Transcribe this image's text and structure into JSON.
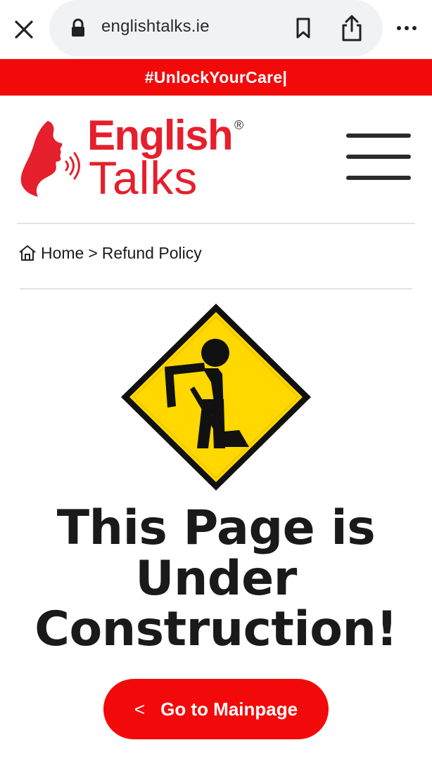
{
  "browser": {
    "url": "englishtalks.ie"
  },
  "announcement": {
    "text": "#UnlockYourCare|"
  },
  "logo": {
    "line1": "English",
    "registered": "®",
    "line2": "Talks"
  },
  "breadcrumb": {
    "home": "Home",
    "separator": ">",
    "current": "Refund Policy"
  },
  "main": {
    "headline_lines": [
      "This Page is",
      "Under",
      "Construction!"
    ]
  },
  "cta": {
    "icon": "<",
    "label": "Go to Mainpage"
  },
  "colors": {
    "brand_red": "#f20a0a",
    "logo_red": "#e5202c",
    "sign_yellow": "#ffd800"
  },
  "icons": [
    "close-icon",
    "lock-icon",
    "bookmark-icon",
    "share-icon",
    "more-icon",
    "menu-icon",
    "home-icon",
    "construction-sign-icon",
    "chevron-left-icon"
  ]
}
